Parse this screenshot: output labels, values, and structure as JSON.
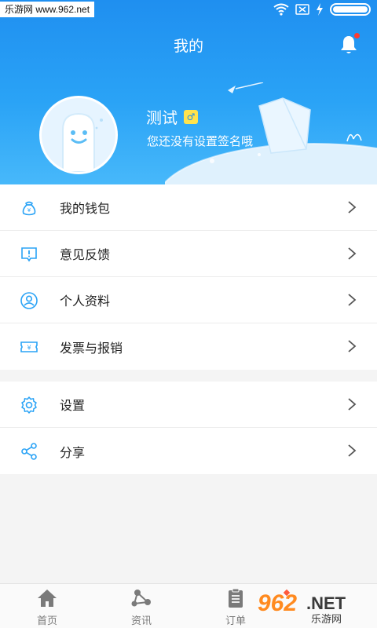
{
  "statusbar": {
    "watermark": "乐游网 www.962.net"
  },
  "header": {
    "title": "我的"
  },
  "profile": {
    "username": "测试",
    "gender_symbol": "♂",
    "signature": "您还没有设置签名哦"
  },
  "menu_group_1": [
    {
      "label": "我的钱包",
      "icon": "wallet-icon"
    },
    {
      "label": "意见反馈",
      "icon": "feedback-icon"
    },
    {
      "label": "个人资料",
      "icon": "profile-icon"
    },
    {
      "label": "发票与报销",
      "icon": "invoice-icon"
    }
  ],
  "menu_group_2": [
    {
      "label": "设置",
      "icon": "gear-icon"
    },
    {
      "label": "分享",
      "icon": "share-icon"
    }
  ],
  "tabbar": [
    {
      "label": "首页",
      "icon": "home-icon"
    },
    {
      "label": "资讯",
      "icon": "news-icon"
    },
    {
      "label": "订单",
      "icon": "order-icon"
    },
    {
      "label": "",
      "icon": "profile-tab-icon"
    }
  ],
  "logo": {
    "text": "962.NET",
    "subtext": "乐游网"
  },
  "colors": {
    "accent": "#1f8ff0",
    "icon_blue": "#2aa3f6",
    "text": "#222222",
    "tab_text": "#7a7a7a"
  }
}
